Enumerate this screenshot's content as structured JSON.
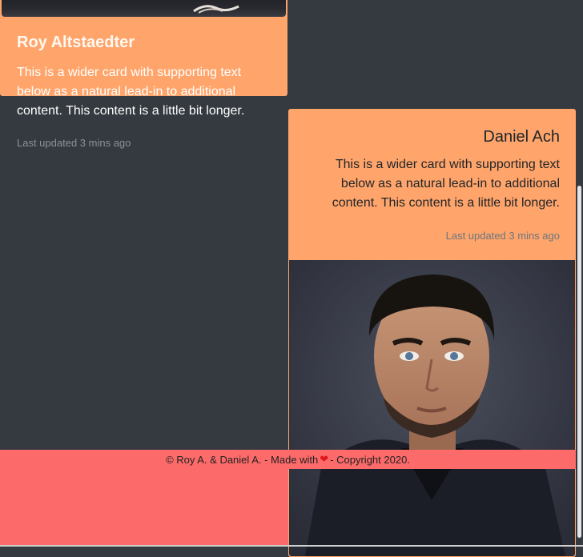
{
  "cards": [
    {
      "name": "Roy Altstaedter",
      "text": "This is a wider card with supporting text below as a natural lead-in to additional content. This content is a little bit longer.",
      "meta": "Last updated 3 mins ago"
    },
    {
      "name": "Daniel Ach",
      "text": "This is a wider card with supporting text below as a natural lead-in to additional content. This content is a little bit longer.",
      "meta": "Last updated 3 mins ago"
    }
  ],
  "footer": {
    "prefix": "© Roy A. & Daniel A. - Made with",
    "heart_icon": "heart-icon",
    "suffix": "- Copyright 2020."
  },
  "colors": {
    "card_bg": "#ffa56b",
    "page_bg": "#343a40",
    "footer_bg": "#fd6a6a",
    "heart": "#e0161b"
  }
}
